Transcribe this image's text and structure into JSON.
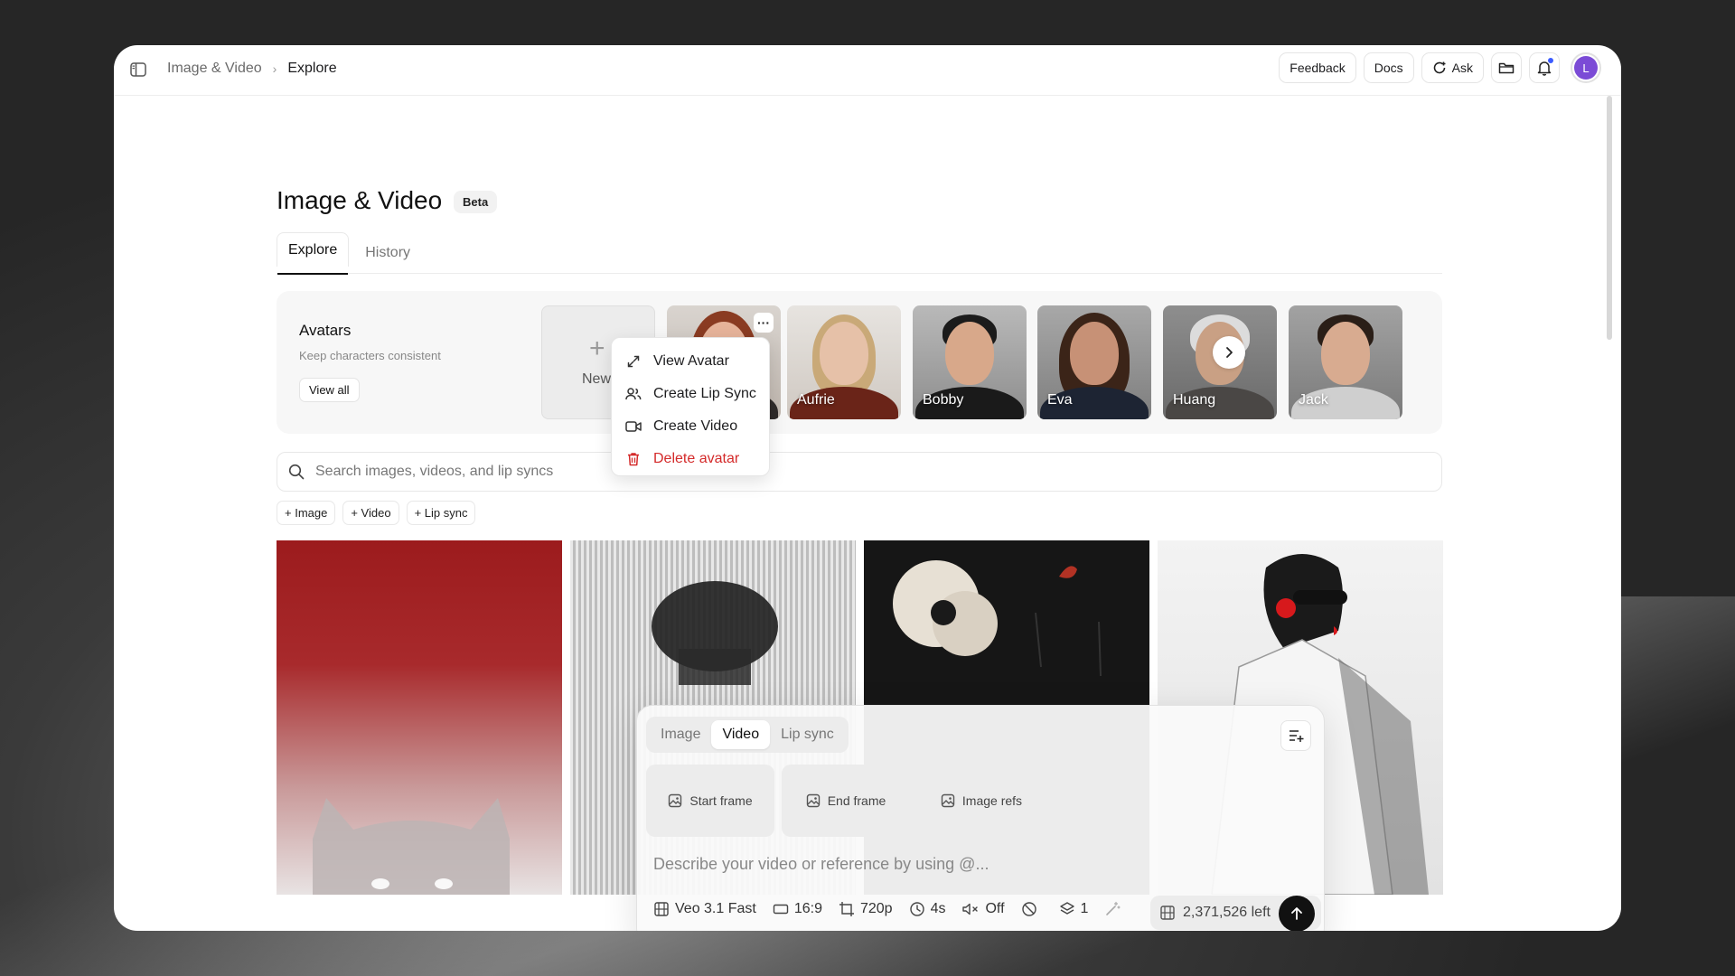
{
  "breadcrumb": {
    "section": "Image & Video",
    "current": "Explore"
  },
  "topbar": {
    "feedback": "Feedback",
    "docs": "Docs",
    "ask": "Ask",
    "user_initial": "L"
  },
  "header": {
    "title": "Image & Video",
    "badge": "Beta"
  },
  "tabs": [
    {
      "label": "Explore",
      "active": true
    },
    {
      "label": "History",
      "active": false
    }
  ],
  "avatars": {
    "title": "Avatars",
    "subtitle": "Keep characters consistent",
    "view_all": "View all",
    "new_label": "New",
    "items": [
      {
        "name": ""
      },
      {
        "name": "Aufrie"
      },
      {
        "name": "Bobby"
      },
      {
        "name": "Eva"
      },
      {
        "name": "Huang"
      },
      {
        "name": "Jack"
      }
    ]
  },
  "context_menu": {
    "view": "View Avatar",
    "lip_sync": "Create Lip Sync",
    "video": "Create Video",
    "delete": "Delete avatar"
  },
  "search": {
    "placeholder": "Search images, videos, and lip syncs"
  },
  "filters": {
    "image": "+ Image",
    "video": "+ Video",
    "lip_sync": "+ Lip sync"
  },
  "composer": {
    "modes": [
      {
        "label": "Image"
      },
      {
        "label": "Video",
        "active": true
      },
      {
        "label": "Lip sync"
      }
    ],
    "start_frame": "Start frame",
    "end_frame": "End frame",
    "image_refs": "Image refs",
    "prompt_placeholder": "Describe your video or reference by using @...",
    "model": "Veo 3.1 Fast",
    "aspect": "16:9",
    "resolution": "720p",
    "duration": "4s",
    "audio": "Off",
    "count": "1",
    "credits": "2,371,526 left"
  },
  "colors": {
    "accent": "#111111",
    "danger": "#d42a2a",
    "user_avatar": "#7b4bd6"
  }
}
